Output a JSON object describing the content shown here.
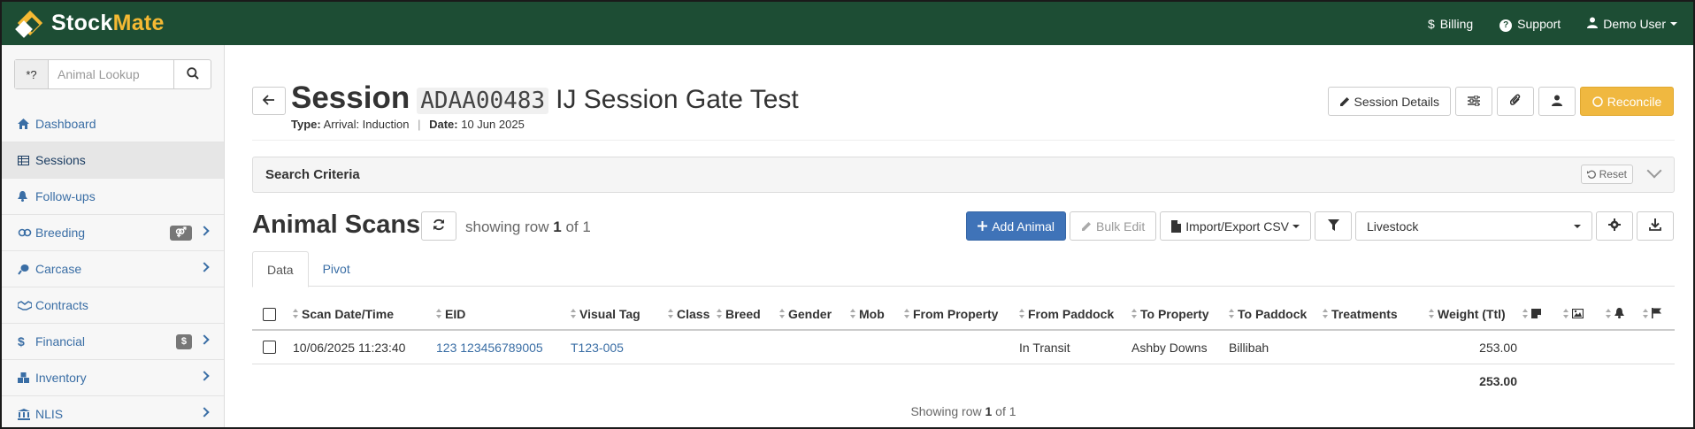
{
  "brand": {
    "stock": "Stock",
    "mate": "Mate"
  },
  "topnav": {
    "billing": "Billing",
    "support": "Support",
    "user": "Demo User"
  },
  "lookup": {
    "prefix": "*?",
    "placeholder": "Animal Lookup"
  },
  "sidebar": {
    "items": [
      {
        "label": "Dashboard",
        "icon": "home-icon"
      },
      {
        "label": "Sessions",
        "icon": "table-icon",
        "active": true
      },
      {
        "label": "Follow-ups",
        "icon": "bell-icon"
      },
      {
        "label": "Breeding",
        "icon": "gender-icon",
        "badge": "⚤",
        "expandable": true
      },
      {
        "label": "Carcase",
        "icon": "drumstick-icon",
        "expandable": true
      },
      {
        "label": "Contracts",
        "icon": "handshake-icon"
      },
      {
        "label": "Financial",
        "icon": "dollar-icon",
        "badge": "$",
        "expandable": true
      },
      {
        "label": "Inventory",
        "icon": "boxes-icon",
        "expandable": true
      },
      {
        "label": "NLIS",
        "icon": "building-icon",
        "expandable": true
      }
    ]
  },
  "session": {
    "label": "Session",
    "code": "ADAA00483",
    "name": "IJ Session Gate Test",
    "type_label": "Type:",
    "type_value": "Arrival: Induction",
    "separator": "|",
    "date_label": "Date:",
    "date_value": "10 Jun 2025"
  },
  "header_buttons": {
    "details": "Session Details",
    "reconcile": "Reconcile"
  },
  "criteria": {
    "title": "Search Criteria",
    "reset": "Reset"
  },
  "scans": {
    "title": "Animal Scans",
    "showing_prefix": "showing row",
    "showing_row": "1",
    "showing_of": "of",
    "showing_total": "1"
  },
  "toolbar": {
    "add": "Add Animal",
    "bulk_edit": "Bulk Edit",
    "import_export": "Import/Export CSV",
    "select_value": "Livestock"
  },
  "tabs": [
    "Data",
    "Pivot"
  ],
  "table": {
    "columns": [
      "Scan Date/Time",
      "EID",
      "Visual Tag",
      "Class",
      "Breed",
      "Gender",
      "Mob",
      "From Property",
      "From Paddock",
      "To Property",
      "To Paddock",
      "Treatments",
      "Weight (Ttl)"
    ],
    "rows": [
      {
        "scan": "10/06/2025 11:23:40",
        "eid": "123 123456789005",
        "visual_tag": "T123-005",
        "class": "",
        "breed": "",
        "gender": "",
        "mob": "",
        "from_property": "",
        "from_paddock": "In Transit",
        "to_property": "Ashby Downs",
        "to_paddock": "Billibah",
        "treatments": "",
        "weight": "253.00"
      }
    ],
    "total_weight": "253.00"
  },
  "footer": {
    "prefix": "Showing row",
    "row": "1",
    "of": "of",
    "total": "1"
  }
}
